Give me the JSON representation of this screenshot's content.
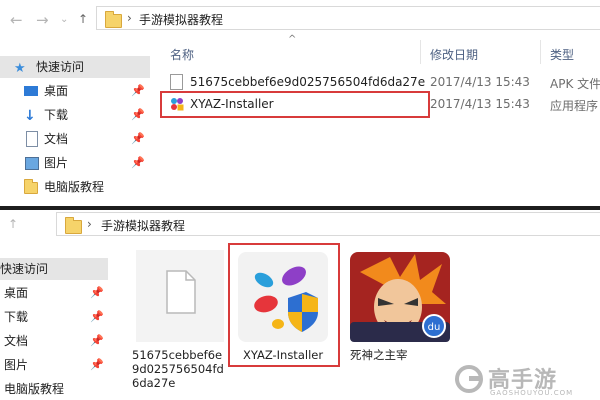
{
  "top_window": {
    "breadcrumb": "手游模拟器教程",
    "sidebar": [
      {
        "label": "快速访问",
        "icon": "star-icon",
        "selected": true,
        "pinned": false
      },
      {
        "label": "桌面",
        "icon": "desktop-icon",
        "pinned": true
      },
      {
        "label": "下载",
        "icon": "download-arrow-icon",
        "pinned": true
      },
      {
        "label": "文档",
        "icon": "document-icon",
        "pinned": true
      },
      {
        "label": "图片",
        "icon": "picture-icon",
        "pinned": true
      },
      {
        "label": "电脑版教程",
        "icon": "folder-icon",
        "pinned": false
      }
    ],
    "columns": {
      "name": "名称",
      "date": "修改日期",
      "type": "类型"
    },
    "files": [
      {
        "name": "51675cebbef6e9d025756504fd6da27e",
        "date": "2017/4/13 15:43",
        "type": "APK 文件"
      },
      {
        "name": "XYAZ-Installer",
        "date": "2017/4/13 15:43",
        "type": "应用程序"
      }
    ]
  },
  "bottom_window": {
    "breadcrumb": "手游模拟器教程",
    "sidebar": [
      {
        "label": "快速访问",
        "selected": true,
        "pinned": false
      },
      {
        "label": "桌面",
        "pinned": true
      },
      {
        "label": "下载",
        "pinned": true
      },
      {
        "label": "文档",
        "pinned": true
      },
      {
        "label": "图片",
        "pinned": true
      },
      {
        "label": "电脑版教程",
        "pinned": false
      }
    ],
    "tiles": [
      {
        "label": "51675cebbef6e9d025756504fd6da27e",
        "icon": "blank-file-icon"
      },
      {
        "label": "XYAZ-Installer",
        "icon": "xyaz-installer-icon"
      },
      {
        "label": "死神之主宰",
        "icon": "game-character-icon"
      }
    ]
  },
  "watermark": {
    "brand": "高手游",
    "domain": "GAOSHOUYOU.COM"
  },
  "colors": {
    "highlight_box": "#d83b3b",
    "selected_bg": "#e5e5e5",
    "folder": "#f6d36a"
  }
}
